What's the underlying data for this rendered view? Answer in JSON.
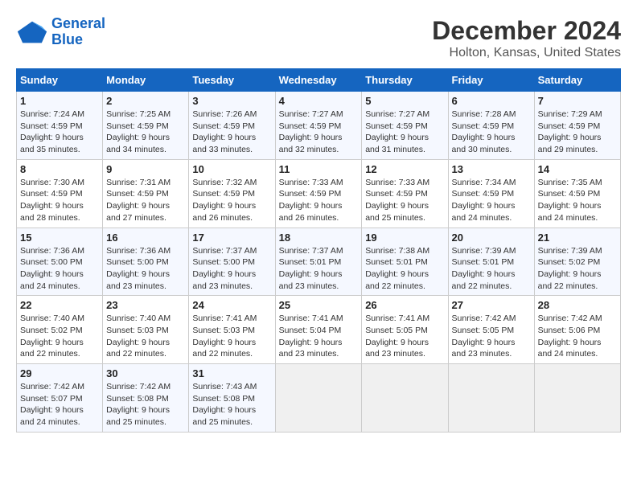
{
  "logo": {
    "line1": "General",
    "line2": "Blue"
  },
  "title": "December 2024",
  "subtitle": "Holton, Kansas, United States",
  "weekdays": [
    "Sunday",
    "Monday",
    "Tuesday",
    "Wednesday",
    "Thursday",
    "Friday",
    "Saturday"
  ],
  "weeks": [
    [
      {
        "day": "1",
        "sunrise": "7:24 AM",
        "sunset": "4:59 PM",
        "daylight": "9 hours and 35 minutes."
      },
      {
        "day": "2",
        "sunrise": "7:25 AM",
        "sunset": "4:59 PM",
        "daylight": "9 hours and 34 minutes."
      },
      {
        "day": "3",
        "sunrise": "7:26 AM",
        "sunset": "4:59 PM",
        "daylight": "9 hours and 33 minutes."
      },
      {
        "day": "4",
        "sunrise": "7:27 AM",
        "sunset": "4:59 PM",
        "daylight": "9 hours and 32 minutes."
      },
      {
        "day": "5",
        "sunrise": "7:27 AM",
        "sunset": "4:59 PM",
        "daylight": "9 hours and 31 minutes."
      },
      {
        "day": "6",
        "sunrise": "7:28 AM",
        "sunset": "4:59 PM",
        "daylight": "9 hours and 30 minutes."
      },
      {
        "day": "7",
        "sunrise": "7:29 AM",
        "sunset": "4:59 PM",
        "daylight": "9 hours and 29 minutes."
      }
    ],
    [
      {
        "day": "8",
        "sunrise": "7:30 AM",
        "sunset": "4:59 PM",
        "daylight": "9 hours and 28 minutes."
      },
      {
        "day": "9",
        "sunrise": "7:31 AM",
        "sunset": "4:59 PM",
        "daylight": "9 hours and 27 minutes."
      },
      {
        "day": "10",
        "sunrise": "7:32 AM",
        "sunset": "4:59 PM",
        "daylight": "9 hours and 26 minutes."
      },
      {
        "day": "11",
        "sunrise": "7:33 AM",
        "sunset": "4:59 PM",
        "daylight": "9 hours and 26 minutes."
      },
      {
        "day": "12",
        "sunrise": "7:33 AM",
        "sunset": "4:59 PM",
        "daylight": "9 hours and 25 minutes."
      },
      {
        "day": "13",
        "sunrise": "7:34 AM",
        "sunset": "4:59 PM",
        "daylight": "9 hours and 24 minutes."
      },
      {
        "day": "14",
        "sunrise": "7:35 AM",
        "sunset": "4:59 PM",
        "daylight": "9 hours and 24 minutes."
      }
    ],
    [
      {
        "day": "15",
        "sunrise": "7:36 AM",
        "sunset": "5:00 PM",
        "daylight": "9 hours and 24 minutes."
      },
      {
        "day": "16",
        "sunrise": "7:36 AM",
        "sunset": "5:00 PM",
        "daylight": "9 hours and 23 minutes."
      },
      {
        "day": "17",
        "sunrise": "7:37 AM",
        "sunset": "5:00 PM",
        "daylight": "9 hours and 23 minutes."
      },
      {
        "day": "18",
        "sunrise": "7:37 AM",
        "sunset": "5:01 PM",
        "daylight": "9 hours and 23 minutes."
      },
      {
        "day": "19",
        "sunrise": "7:38 AM",
        "sunset": "5:01 PM",
        "daylight": "9 hours and 22 minutes."
      },
      {
        "day": "20",
        "sunrise": "7:39 AM",
        "sunset": "5:01 PM",
        "daylight": "9 hours and 22 minutes."
      },
      {
        "day": "21",
        "sunrise": "7:39 AM",
        "sunset": "5:02 PM",
        "daylight": "9 hours and 22 minutes."
      }
    ],
    [
      {
        "day": "22",
        "sunrise": "7:40 AM",
        "sunset": "5:02 PM",
        "daylight": "9 hours and 22 minutes."
      },
      {
        "day": "23",
        "sunrise": "7:40 AM",
        "sunset": "5:03 PM",
        "daylight": "9 hours and 22 minutes."
      },
      {
        "day": "24",
        "sunrise": "7:41 AM",
        "sunset": "5:03 PM",
        "daylight": "9 hours and 22 minutes."
      },
      {
        "day": "25",
        "sunrise": "7:41 AM",
        "sunset": "5:04 PM",
        "daylight": "9 hours and 23 minutes."
      },
      {
        "day": "26",
        "sunrise": "7:41 AM",
        "sunset": "5:05 PM",
        "daylight": "9 hours and 23 minutes."
      },
      {
        "day": "27",
        "sunrise": "7:42 AM",
        "sunset": "5:05 PM",
        "daylight": "9 hours and 23 minutes."
      },
      {
        "day": "28",
        "sunrise": "7:42 AM",
        "sunset": "5:06 PM",
        "daylight": "9 hours and 24 minutes."
      }
    ],
    [
      {
        "day": "29",
        "sunrise": "7:42 AM",
        "sunset": "5:07 PM",
        "daylight": "9 hours and 24 minutes."
      },
      {
        "day": "30",
        "sunrise": "7:42 AM",
        "sunset": "5:08 PM",
        "daylight": "9 hours and 25 minutes."
      },
      {
        "day": "31",
        "sunrise": "7:43 AM",
        "sunset": "5:08 PM",
        "daylight": "9 hours and 25 minutes."
      },
      null,
      null,
      null,
      null
    ]
  ]
}
